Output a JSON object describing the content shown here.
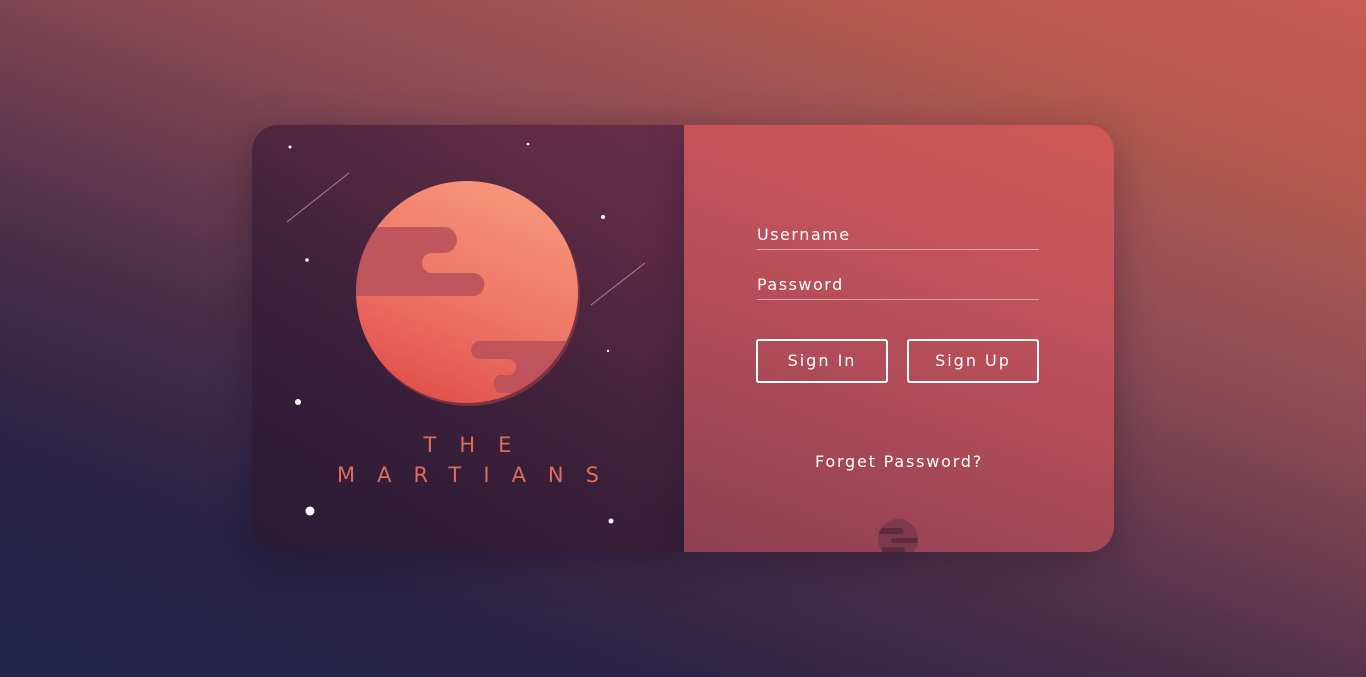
{
  "brand": {
    "title_line1": "THE",
    "title_line2": "MARTIANS"
  },
  "form": {
    "username_placeholder": "Username",
    "password_placeholder": "Password",
    "signin_label": "Sign In",
    "signup_label": "Sign Up",
    "forgot_label": "Forget Password?"
  },
  "colors": {
    "accent": "#e06a5c",
    "planet_light": "#f4907a",
    "planet_dark": "#e15a50",
    "card_right": "#c4535a",
    "card_left": "#3a1f3a"
  },
  "icons": {
    "planet": "mars-planet-illustration",
    "mini_planet": "mini-planet-icon",
    "stars": "star-icons",
    "shooting_stars": "shooting-star-icons"
  }
}
